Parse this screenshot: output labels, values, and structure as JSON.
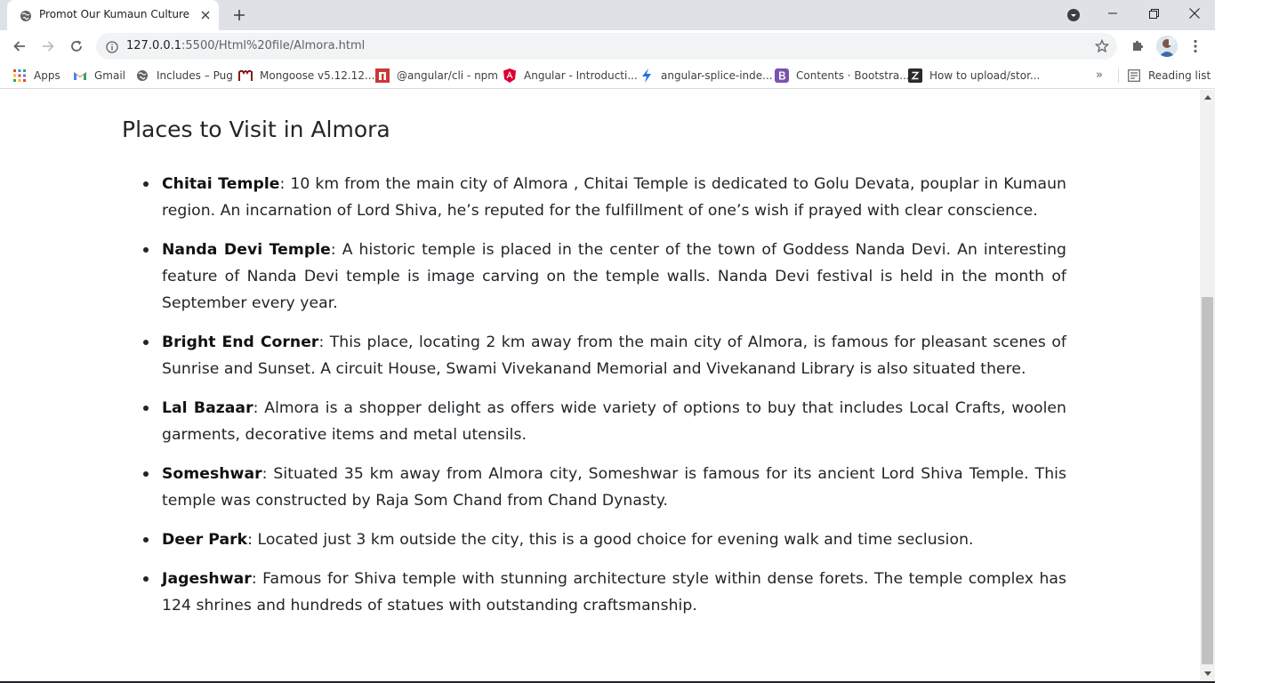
{
  "tab": {
    "title": "Promot Our Kumaun Culture"
  },
  "address_bar": {
    "host": "127.0.0.1",
    "path": ":5500/Html%20file/Almora.html"
  },
  "bookmarks": [
    {
      "label": "Apps",
      "icon": "apps-grid-icon"
    },
    {
      "label": "Gmail",
      "icon": "gmail-icon"
    },
    {
      "label": "Includes – Pug",
      "icon": "globe-icon"
    },
    {
      "label": "Mongoose v5.12.12...",
      "icon": "mongoose-icon"
    },
    {
      "label": "@angular/cli - npm",
      "icon": "npm-icon"
    },
    {
      "label": "Angular - Introducti...",
      "icon": "angular-icon"
    },
    {
      "label": "angular-splice-inde...",
      "icon": "lightning-icon"
    },
    {
      "label": "Contents · Bootstra...",
      "icon": "bootstrap-icon"
    },
    {
      "label": "How to upload/stor...",
      "icon": "z-icon"
    }
  ],
  "bookmarks_more": "»",
  "reading_list": "Reading list",
  "page": {
    "title": "Places to Visit in Almora",
    "places": [
      {
        "name": "Chitai Temple",
        "text": ": 10 km from the main city of Almora , Chitai Temple is dedicated to Golu Devata, pouplar in Kumaun region. An incarnation of Lord Shiva, he’s reputed for the fulfillment of one’s wish if prayed with clear conscience."
      },
      {
        "name": "Nanda Devi Temple",
        "text": ":  A historic temple is placed in the center of the town of Goddess Nanda Devi. An interesting feature of Nanda Devi temple is image carving on the temple walls. Nanda Devi festival is held in the month of September every year."
      },
      {
        "name": "Bright End Corner",
        "text": ": This place, locating 2 km away from the main city of Almora, is famous for pleasant scenes of Sunrise and Sunset. A circuit House, Swami Vivekanand Memorial and Vivekanand Library is also situated there."
      },
      {
        "name": "Lal Bazaar",
        "text": ": Almora is a shopper delight as offers wide variety of options to buy that includes Local Crafts, woolen garments, decorative items and metal utensils."
      },
      {
        "name": "Someshwar",
        "text": ": Situated 35 km away from Almora city, Someshwar is famous for its ancient Lord Shiva Temple. This temple was constructed by Raja Som Chand from Chand Dynasty."
      },
      {
        "name": "Deer Park",
        "text": ": Located just 3 km outside the city, this is a good choice for evening walk and time seclusion."
      },
      {
        "name": "Jageshwar",
        "text": ": Famous for Shiva temple with stunning architecture style within dense forets. The temple complex has 124 shrines and hundreds of statues with outstanding craftsmanship."
      }
    ]
  }
}
